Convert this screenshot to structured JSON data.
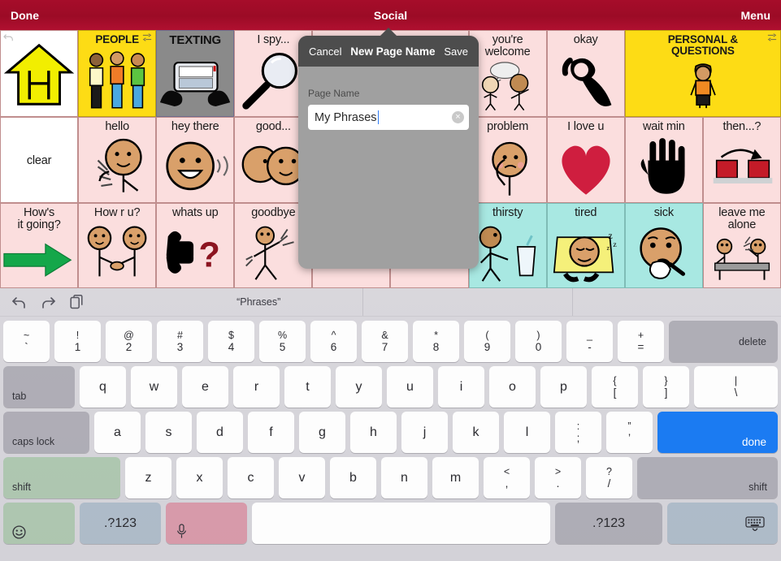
{
  "topbar": {
    "left_label": "Done",
    "title": "Social",
    "right_label": "Menu"
  },
  "board": {
    "rows": [
      [
        {
          "label": "",
          "art": "home-house",
          "style": "white",
          "corner": "undo"
        },
        {
          "label": "PEOPLE",
          "art": "three-people",
          "style": "yellow",
          "corner": "link"
        },
        {
          "label": "TEXTING",
          "art": "texting-hands",
          "style": "gray"
        },
        {
          "label": "I spy...",
          "art": "magnifier",
          "style": "pink"
        },
        {
          "label": "",
          "art": "hidden",
          "style": "pink"
        },
        {
          "label": "",
          "art": "hidden",
          "style": "pink"
        },
        {
          "label": "you're\nwelcome",
          "art": "two-people-talk",
          "style": "pink"
        },
        {
          "label": "okay",
          "art": "ok-hand",
          "style": "pink"
        },
        {
          "label": "PERSONAL &\nQUESTIONS",
          "art": "boy-standing",
          "style": "yellow",
          "span": 2,
          "corner": "link"
        }
      ],
      [
        {
          "label": "clear",
          "art": "none",
          "style": "white"
        },
        {
          "label": "hello",
          "art": "waving-face",
          "style": "pink"
        },
        {
          "label": "hey there",
          "art": "smiling-face",
          "style": "pink"
        },
        {
          "label": "good...",
          "art": "two-faces",
          "style": "pink"
        },
        {
          "label": "",
          "art": "hidden",
          "style": "pink"
        },
        {
          "label": "",
          "art": "hidden",
          "style": "pink"
        },
        {
          "label": "problem",
          "art": "worried-person",
          "style": "pink"
        },
        {
          "label": "I love u",
          "art": "heart",
          "style": "pink"
        },
        {
          "label": "wait min",
          "art": "open-hand",
          "style": "pink"
        },
        {
          "label": "then...?",
          "art": "sequence-arrow",
          "style": "pink"
        }
      ],
      [
        {
          "label": "How's\nit going?",
          "art": "green-arrow",
          "style": "pink"
        },
        {
          "label": "How r u?",
          "art": "handshake",
          "style": "pink"
        },
        {
          "label": "whats up",
          "art": "thumbs-question",
          "style": "pink"
        },
        {
          "label": "goodbye",
          "art": "waving-person",
          "style": "pink"
        },
        {
          "label": "",
          "art": "hidden",
          "style": "pink"
        },
        {
          "label": "",
          "art": "hidden",
          "style": "pink"
        },
        {
          "label": "thirsty",
          "art": "thirsty-person",
          "style": "cyan"
        },
        {
          "label": "tired",
          "art": "sleeping-person",
          "style": "cyan"
        },
        {
          "label": "sick",
          "art": "sick-person",
          "style": "cyan"
        },
        {
          "label": "leave me\nalone",
          "art": "two-people-table",
          "style": "pink"
        }
      ]
    ]
  },
  "dialog": {
    "cancel_label": "Cancel",
    "title": "New Page Name",
    "save_label": "Save",
    "field_label": "Page Name",
    "field_value": "My Phrases",
    "clear_icon": "×"
  },
  "keyboard": {
    "toolbar": {
      "undo_icon": "undo-icon",
      "redo_icon": "redo-icon",
      "paste_icon": "paste-icon",
      "suggestions": [
        "“Phrases”",
        "",
        ""
      ]
    },
    "row_numbers": [
      {
        "up": "~",
        "dn": "`"
      },
      {
        "up": "!",
        "dn": "1"
      },
      {
        "up": "@",
        "dn": "2"
      },
      {
        "up": "#",
        "dn": "3"
      },
      {
        "up": "$",
        "dn": "4"
      },
      {
        "up": "%",
        "dn": "5"
      },
      {
        "up": "^",
        "dn": "6"
      },
      {
        "up": "&",
        "dn": "7"
      },
      {
        "up": "*",
        "dn": "8"
      },
      {
        "up": "(",
        "dn": "9"
      },
      {
        "up": ")",
        "dn": "0"
      },
      {
        "up": "_",
        "dn": "-"
      },
      {
        "up": "+",
        "dn": "="
      }
    ],
    "delete_label": "delete",
    "tab_label": "tab",
    "row_q": [
      "q",
      "w",
      "e",
      "r",
      "t",
      "y",
      "u",
      "i",
      "o",
      "p"
    ],
    "row_q_sym": [
      {
        "up": "{",
        "dn": "["
      },
      {
        "up": "}",
        "dn": "]"
      },
      {
        "up": "|",
        "dn": "\\"
      }
    ],
    "capslock_label": "caps lock",
    "row_a": [
      "a",
      "s",
      "d",
      "f",
      "g",
      "h",
      "j",
      "k",
      "l"
    ],
    "row_a_sym": [
      {
        "up": ":",
        "dn": ";"
      },
      {
        "up": "”",
        "dn": "’"
      }
    ],
    "done_label": "done",
    "shift_left_label": "shift",
    "row_z": [
      "z",
      "x",
      "c",
      "v",
      "b",
      "n",
      "m"
    ],
    "row_z_sym": [
      {
        "up": "<",
        "dn": ","
      },
      {
        "up": ">",
        "dn": "."
      },
      {
        "up": "?",
        "dn": "/"
      }
    ],
    "shift_right_label": "shift",
    "emoji_icon": "emoji-icon",
    "num_left_label": ".?123",
    "mic_icon": "microphone-icon",
    "space_label": "",
    "num_right_label": ".?123",
    "dismiss_icon": "keyboard-dismiss-icon"
  },
  "colors": {
    "topbar": "#a60d2a",
    "pink_cell": "#fbdede",
    "yellow_cell": "#fddc15",
    "cyan_cell": "#a8e8e2",
    "gray_cell": "#8a8a8a",
    "done_key": "#1b7bf2",
    "caret": "#2f7cf6"
  }
}
